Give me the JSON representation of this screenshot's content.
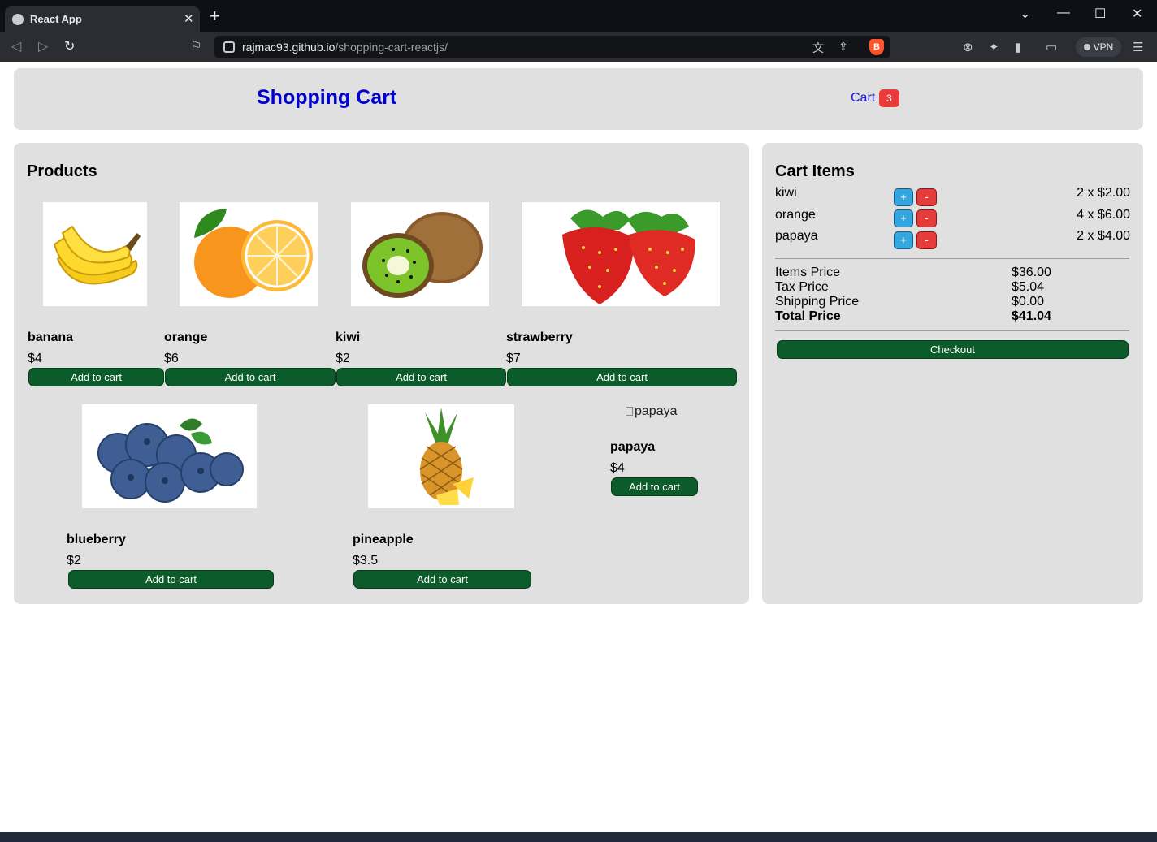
{
  "browser": {
    "tab_title": "React App",
    "tab_close": "✕",
    "new_tab": "+",
    "url_host": "rajmac93.github.io",
    "url_path": "/shopping-cart-reactjs/",
    "vpn_label": "VPN"
  },
  "header": {
    "brand": "Shopping Cart",
    "cart_label": "Cart",
    "cart_count": "3"
  },
  "products": {
    "title": "Products",
    "add_label": "Add to cart",
    "items": [
      {
        "name": "banana",
        "price": "$4"
      },
      {
        "name": "orange",
        "price": "$6"
      },
      {
        "name": "kiwi",
        "price": "$2"
      },
      {
        "name": "strawberry",
        "price": "$7"
      },
      {
        "name": "blueberry",
        "price": "$2"
      },
      {
        "name": "pineapple",
        "price": "$3.5"
      },
      {
        "name": "papaya",
        "price": "$4",
        "image_alt": "papaya"
      }
    ]
  },
  "cart": {
    "title": "Cart Items",
    "plus": "+",
    "minus": "-",
    "items": [
      {
        "name": "kiwi",
        "qty_price": "2 x $2.00"
      },
      {
        "name": "orange",
        "qty_price": "4 x $6.00"
      },
      {
        "name": "papaya",
        "qty_price": "2 x $4.00"
      }
    ],
    "summary": {
      "items_label": "Items Price",
      "items_value": "$36.00",
      "tax_label": "Tax Price",
      "tax_value": "$5.04",
      "shipping_label": "Shipping Price",
      "shipping_value": "$0.00",
      "total_label": "Total Price",
      "total_value": "$41.04"
    },
    "checkout_label": "Checkout"
  },
  "colors": {
    "header_bg": "#e0e0e0",
    "brand": "#0000d0",
    "button_green": "#0c5b2a",
    "badge_red": "#ea3a3a",
    "plus_blue": "#35a7e0"
  }
}
